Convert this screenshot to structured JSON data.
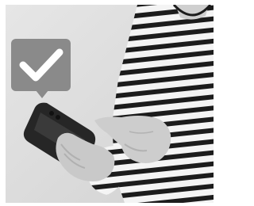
{
  "photo": {
    "subject": "person-holding-smartphone",
    "badge_icon": "check-icon",
    "colors": {
      "background": "#dcdcdc",
      "badge": "#8a8a8a",
      "check": "#ffffff",
      "shirt_light": "#f4f4f4",
      "shirt_stripe": "#1c1c1c",
      "skin": "#c9c9c9",
      "phone": "#262626"
    }
  }
}
